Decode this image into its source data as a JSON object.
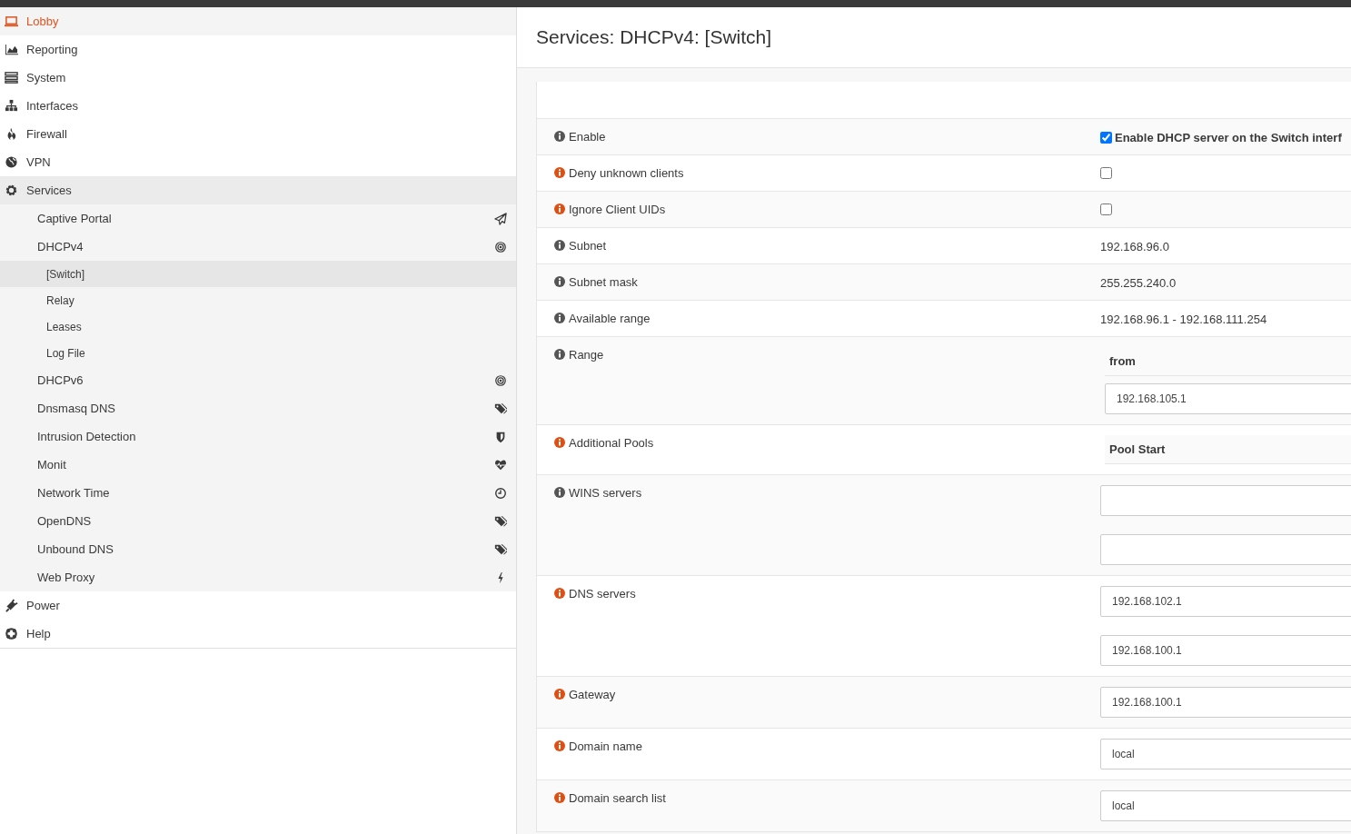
{
  "sidebar": {
    "items": [
      {
        "label": "Lobby",
        "selected": true
      },
      {
        "label": "Reporting",
        "selected": false
      },
      {
        "label": "System",
        "selected": false
      },
      {
        "label": "Interfaces",
        "selected": false
      },
      {
        "label": "Firewall",
        "selected": false
      },
      {
        "label": "VPN",
        "selected": false
      },
      {
        "label": "Services",
        "selected": false,
        "expanded": true,
        "children": [
          {
            "label": "Captive Portal",
            "selected": false
          },
          {
            "label": "DHCPv4",
            "selected": false,
            "expanded": true,
            "children": [
              {
                "label": "[Switch]",
                "selected": true
              },
              {
                "label": "Relay",
                "selected": false
              },
              {
                "label": "Leases",
                "selected": false
              },
              {
                "label": "Log File",
                "selected": false
              }
            ]
          },
          {
            "label": "DHCPv6",
            "selected": false
          },
          {
            "label": "Dnsmasq DNS",
            "selected": false
          },
          {
            "label": "Intrusion Detection",
            "selected": false
          },
          {
            "label": "Monit",
            "selected": false
          },
          {
            "label": "Network Time",
            "selected": false
          },
          {
            "label": "OpenDNS",
            "selected": false
          },
          {
            "label": "Unbound DNS",
            "selected": false
          },
          {
            "label": "Web Proxy",
            "selected": false
          }
        ]
      },
      {
        "label": "Power",
        "selected": false
      },
      {
        "label": "Help",
        "selected": false
      }
    ]
  },
  "page": {
    "title": "Services: DHCPv4: [Switch]"
  },
  "form": {
    "rows": [
      {
        "label": "Enable",
        "color": "#555555",
        "kind": "checkbox",
        "checked": true,
        "text": "Enable DHCP server on the Switch interf"
      },
      {
        "label": "Deny unknown clients",
        "color": "#e04e12",
        "kind": "checkbox",
        "checked": false
      },
      {
        "label": "Ignore Client UIDs",
        "color": "#e04e12",
        "kind": "checkbox",
        "checked": false
      },
      {
        "label": "Subnet",
        "color": "#555555",
        "kind": "text",
        "value": "192.168.96.0"
      },
      {
        "label": "Subnet mask",
        "color": "#555555",
        "kind": "text",
        "value": "255.255.240.0"
      },
      {
        "label": "Available range",
        "color": "#555555",
        "kind": "text",
        "value": "192.168.96.1 - 192.168.111.254"
      },
      {
        "label": "Range",
        "color": "#555555",
        "kind": "inputs",
        "header": "from",
        "fields": [
          {
            "kind": "text",
            "value": "192.168.105.1"
          }
        ]
      },
      {
        "label": "Additional Pools",
        "color": "#e04e12",
        "kind": "inputs",
        "header": "Pool Start"
      },
      {
        "label": "WINS servers",
        "color": "#555555",
        "kind": "inputs",
        "fields": [
          {
            "kind": "blank"
          },
          {
            "kind": "blank"
          }
        ]
      },
      {
        "label": "DNS servers",
        "color": "#e04e12",
        "kind": "inputs",
        "fields": [
          {
            "kind": "text",
            "value": "192.168.102.1"
          },
          {
            "kind": "text",
            "value": "192.168.100.1"
          }
        ]
      },
      {
        "label": "Gateway",
        "color": "#e04e12",
        "kind": "inputs",
        "fields": [
          {
            "kind": "text",
            "value": "192.168.100.1"
          }
        ]
      },
      {
        "label": "Domain name",
        "color": "#e04e12",
        "kind": "inputs",
        "fields": [
          {
            "kind": "text",
            "value": "local"
          }
        ]
      },
      {
        "label": "Domain search list",
        "color": "#e04e12",
        "kind": "inputs",
        "fields": [
          {
            "kind": "text",
            "value": "local"
          }
        ]
      }
    ]
  }
}
